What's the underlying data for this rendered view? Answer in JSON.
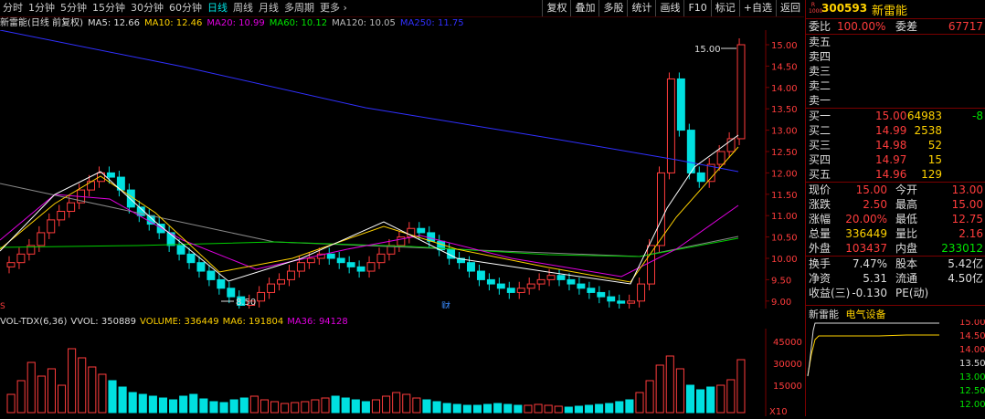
{
  "toolbar": {
    "periods": [
      "分时",
      "1分钟",
      "5分钟",
      "15分钟",
      "30分钟",
      "60分钟",
      "日线",
      "周线",
      "月线",
      "多周期",
      "更多 ›"
    ],
    "active_period": "日线",
    "tools": [
      "复权",
      "叠加",
      "多股",
      "统计",
      "画线",
      "F10",
      "标记",
      "+自选",
      "返回"
    ]
  },
  "ma_line": {
    "title": "新雷能(日线 前复权)",
    "ma5": "MA5: 12.66",
    "ma10": "MA10: 12.46",
    "ma20": "MA20: 10.99",
    "ma60": "MA60: 10.12",
    "ma120": "MA120: 10.05",
    "ma250": "MA250: 11.75"
  },
  "price_axis": [
    "15.00",
    "14.50",
    "14.00",
    "13.50",
    "13.00",
    "12.50",
    "12.00",
    "11.50",
    "11.00",
    "10.50",
    "10.00",
    "9.50",
    "9.00"
  ],
  "annotations": {
    "high_label": "15.00",
    "low_label": "8.50",
    "cai_label": "财",
    "s_label": "S"
  },
  "vol_header": {
    "title": "VOL-TDX(6,36)",
    "vvol": "VVOL: 350889",
    "volume": "VOLUME: 336449",
    "ma6": "MA6: 191804",
    "ma36": "MA36: 94128"
  },
  "vol_axis": [
    "45000",
    "30000",
    "15000"
  ],
  "vol_unit": "X10",
  "stock": {
    "badge_r": "R",
    "badge_num": "1000",
    "code": "300593",
    "name": "新雷能"
  },
  "order_ratio": {
    "label1": "委比",
    "v1": "100.00%",
    "label2": "委差",
    "v2": "67717"
  },
  "sells": [
    {
      "label": "卖五"
    },
    {
      "label": "卖四"
    },
    {
      "label": "卖三"
    },
    {
      "label": "卖二"
    },
    {
      "label": "卖一"
    }
  ],
  "buys": [
    {
      "label": "买一",
      "price": "15.00",
      "vol": "64983",
      "chg": "-8"
    },
    {
      "label": "买二",
      "price": "14.99",
      "vol": "2538",
      "chg": ""
    },
    {
      "label": "买三",
      "price": "14.98",
      "vol": "52",
      "chg": ""
    },
    {
      "label": "买四",
      "price": "14.97",
      "vol": "15",
      "chg": ""
    },
    {
      "label": "买五",
      "price": "14.96",
      "vol": "129",
      "chg": ""
    }
  ],
  "quote": [
    {
      "l1": "现价",
      "v1": "15.00",
      "l2": "今开",
      "v2": "13.00"
    },
    {
      "l1": "涨跌",
      "v1": "2.50",
      "l2": "最高",
      "v2": "15.00"
    },
    {
      "l1": "涨幅",
      "v1": "20.00%",
      "l2": "最低",
      "v2": "12.75"
    },
    {
      "l1": "总量",
      "v1": "336449",
      "l2": "量比",
      "v2": "2.16"
    },
    {
      "l1": "外盘",
      "v1": "103437",
      "l2": "内盘",
      "v2": "233012"
    }
  ],
  "fundamentals": [
    {
      "l1": "换手",
      "v1": "7.47%",
      "l2": "股本",
      "v2": "5.42亿"
    },
    {
      "l1": "净资",
      "v1": "5.31",
      "l2": "流通",
      "v2": "4.50亿"
    },
    {
      "l1": "收益(三)",
      "v1": "-0.130",
      "l2": "PE(动)",
      "v2": ""
    }
  ],
  "mini": {
    "name": "新雷能",
    "sector": "电气设备",
    "axis": [
      "15.00",
      "14.50",
      "14.00",
      "13.50",
      "13.00",
      "12.50",
      "12.00"
    ]
  },
  "colors": {
    "up": "#ff3c3c",
    "down": "#00e0e0",
    "ma5": "#ffffff",
    "ma10": "#ffd200",
    "ma20": "#e000e0",
    "ma60": "#00d000",
    "ma120": "#888888",
    "ma250": "#3030ff"
  }
}
